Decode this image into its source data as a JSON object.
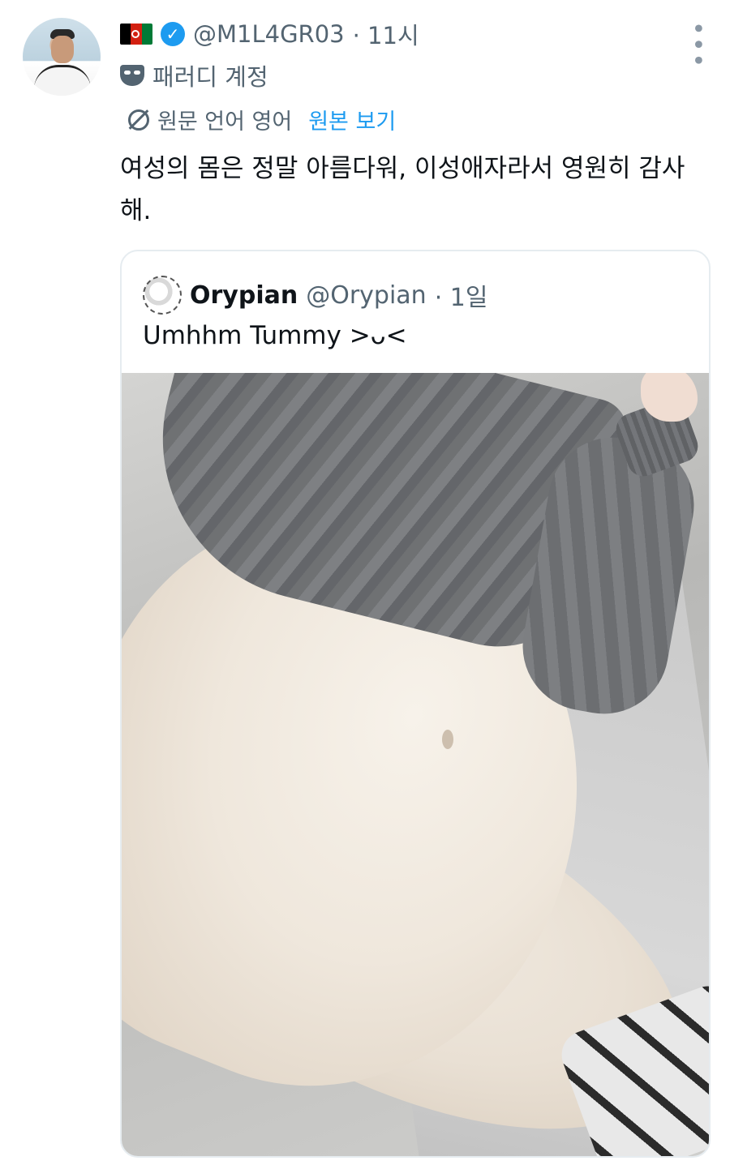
{
  "tweet": {
    "handle": "@M1L4GR03",
    "time": "· 11시",
    "parody_label": "패러디 계정",
    "translation_note": "원문 언어 영어",
    "show_original": "원본 보기",
    "text": "여성의 몸은 정말 아름다워, 이성애자라서 영원히 감사해.",
    "icons": [
      "flag-icon",
      "verified-badge-icon",
      "more-options-icon",
      "parody-mask-icon",
      "translate-icon"
    ]
  },
  "quoted": {
    "name": "Orypian",
    "handle": "@Orypian",
    "time": "· 1일",
    "text": "Umhhm Tummy >ᴗ<"
  },
  "colors": {
    "accent": "#1d9bf0",
    "secondary_text": "#536471",
    "primary_text": "#0f1419",
    "border": "#e6ecf0"
  }
}
